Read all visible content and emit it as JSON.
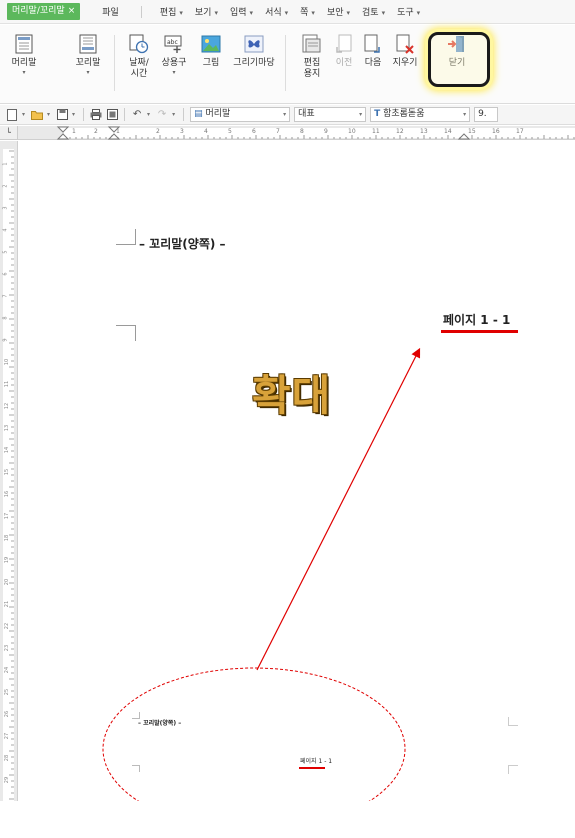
{
  "menubar": {
    "active_tab": "머리말/꼬리말",
    "close_mark": "×",
    "items": [
      "파일",
      "편집",
      "보기",
      "입력",
      "서식",
      "쪽",
      "보안",
      "검토",
      "도구"
    ]
  },
  "ribbon": {
    "buttons": [
      {
        "id": "header",
        "label": "머리말",
        "sub": "▾",
        "icon": "header-icon"
      },
      {
        "id": "footer",
        "label": "꼬리말",
        "sub": "▾",
        "icon": "footer-icon"
      },
      {
        "id": "datetime",
        "label": "날짜/",
        "label2": "시간",
        "sub": "▾",
        "icon": "clock-doc-icon"
      },
      {
        "id": "phrase",
        "label": "상용구",
        "sub": "▾",
        "icon": "abc-phrase-icon"
      },
      {
        "id": "picture",
        "label": "그림",
        "icon": "picture-icon"
      },
      {
        "id": "drawing",
        "label": "그리기마당",
        "icon": "butterfly-icon"
      },
      {
        "id": "edit_paper",
        "label": "편집",
        "label2": "용지",
        "icon": "edit-paper-icon"
      },
      {
        "id": "prev",
        "label": "이전",
        "icon": "previous-icon",
        "disabled": true
      },
      {
        "id": "next",
        "label": "다음",
        "icon": "next-icon"
      },
      {
        "id": "erase",
        "label": "지우기",
        "icon": "erase-icon"
      },
      {
        "id": "close",
        "label": "닫기",
        "icon": "close-door-icon"
      }
    ]
  },
  "toolbar": {
    "style_value": "머리말",
    "font_lang": "대표",
    "font_name": "함초롬돋움",
    "font_size": "9."
  },
  "ruler": {
    "h_numbers": [
      "1",
      "2",
      "1",
      "2",
      "3",
      "4",
      "5",
      "6",
      "7",
      "8",
      "9",
      "10",
      "11",
      "12",
      "13",
      "14",
      "15",
      "16",
      "17"
    ],
    "v_numbers": [
      "1",
      "2",
      "3",
      "4",
      "5",
      "6",
      "7",
      "8",
      "9",
      "10",
      "11",
      "12",
      "13",
      "14",
      "15",
      "16",
      "17",
      "18",
      "19",
      "20",
      "21",
      "22",
      "23",
      "24",
      "25",
      "26",
      "27",
      "28",
      "29"
    ]
  },
  "document": {
    "footer_text": "– 꼬리말(양쪽) –",
    "page_label": "페이지 1 - 1",
    "zoom_annotation": "확대"
  },
  "colors": {
    "active_tab": "#5cb85c",
    "highlight_border": "#1a1a1a",
    "highlight_glow": "#ffe94d",
    "annotation_red": "#e00000",
    "zoom_text_fill": "#d8a23a"
  }
}
